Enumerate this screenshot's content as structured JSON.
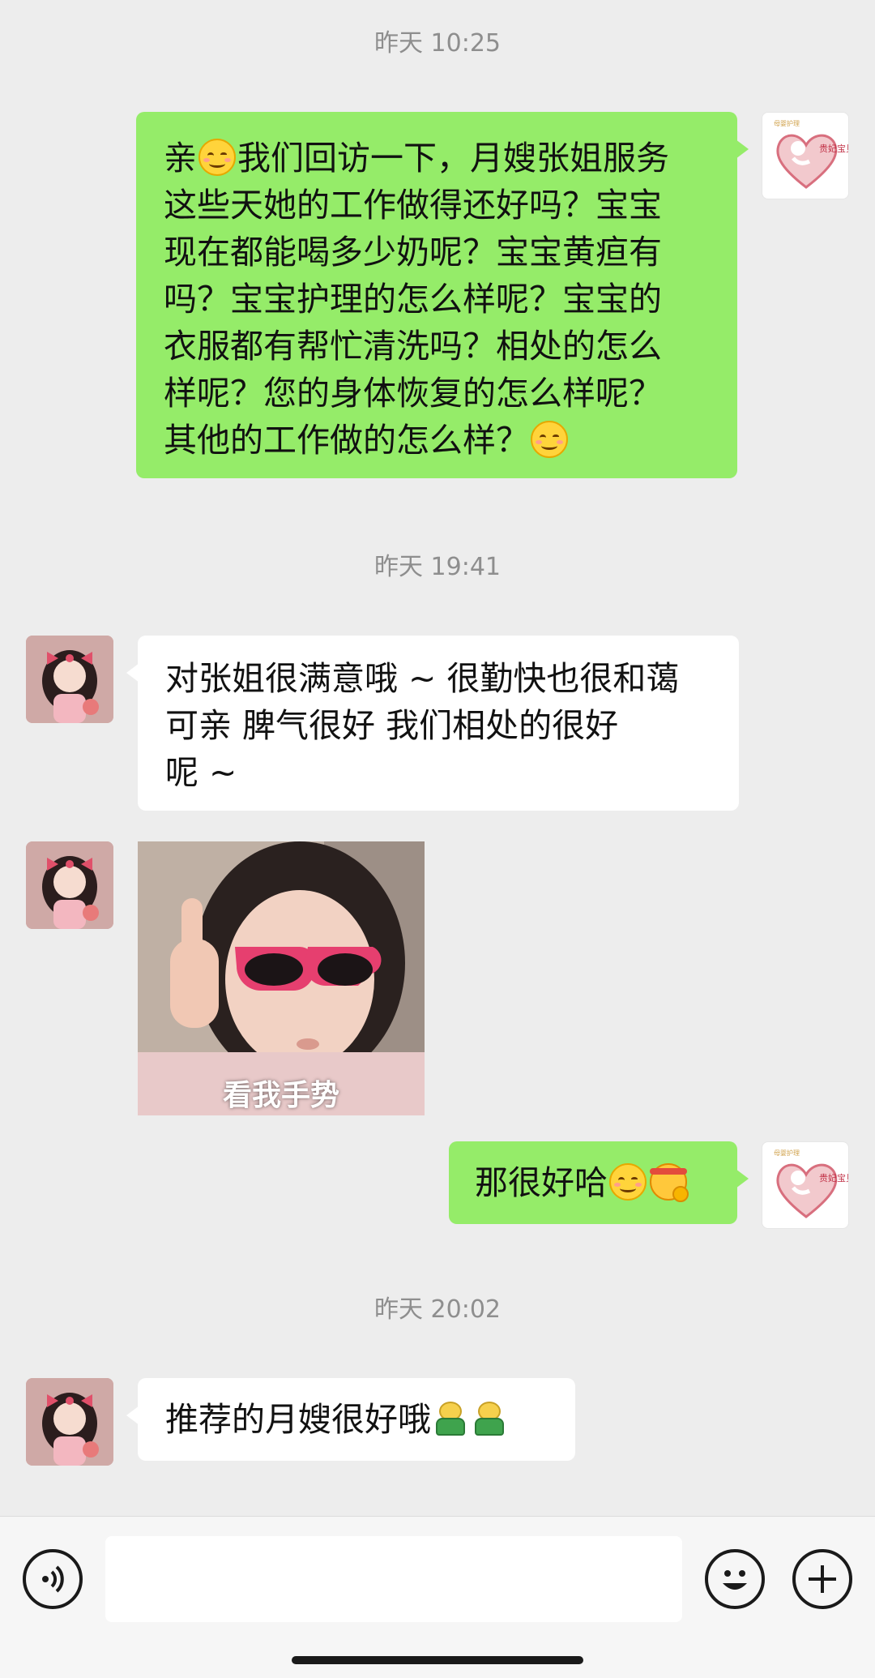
{
  "timestamps": [
    "昨天 10:25",
    "昨天 19:41",
    "昨天 20:02"
  ],
  "messages": {
    "m1": {
      "sender": "self",
      "lines": [
        "亲",
        "我们回访一下，月嫂张姐服务",
        "这些天她的工作做得还好吗？宝宝",
        "现在都能喝多少奶呢？宝宝黄疸有",
        "吗？宝宝护理的怎么样呢？宝宝的",
        "衣服都有帮忙清洗吗？相处的怎么",
        "样呢？您的身体恢复的怎么样呢？",
        "其他的工作做的怎么样？"
      ]
    },
    "m2": {
      "sender": "other",
      "lines": [
        "对张姐很满意哦 ~ 很勤快也很和蔼",
        "可亲 脾气很好 我们相处的很好",
        "呢 ~"
      ]
    },
    "m3": {
      "sender": "other",
      "type": "image",
      "caption": "看我手势"
    },
    "m4": {
      "sender": "self",
      "text": "那很好哈"
    },
    "m5": {
      "sender": "other",
      "text": "推荐的月嫂很好哦"
    }
  },
  "self_avatar": {
    "logo_text": "贵妃宝贝",
    "small_text": "母婴护理"
  },
  "emoji": [
    "smile",
    "thinking-face",
    "bot-figure"
  ],
  "colors": {
    "self_bubble": "#95ec69",
    "other_bubble": "#ffffff",
    "background": "#ededed"
  },
  "icons": [
    "voice-icon",
    "emoji-icon",
    "plus-icon"
  ]
}
